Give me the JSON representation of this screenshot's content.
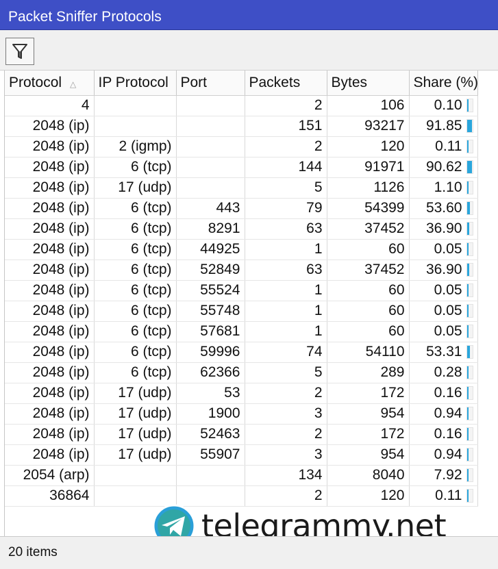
{
  "window": {
    "title": "Packet Sniffer Protocols"
  },
  "toolbar": {
    "filter_icon": "filter-funnel-icon"
  },
  "columns": [
    "Protocol",
    "IP Protocol",
    "Port",
    "Packets",
    "Bytes",
    "Share (%)"
  ],
  "rows": [
    {
      "protocol": "4",
      "ip_protocol": "",
      "port": "",
      "packets": "2",
      "bytes": "106",
      "share": "0.10"
    },
    {
      "protocol": "2048 (ip)",
      "ip_protocol": "",
      "port": "",
      "packets": "151",
      "bytes": "93217",
      "share": "91.85"
    },
    {
      "protocol": "2048 (ip)",
      "ip_protocol": "2 (igmp)",
      "port": "",
      "packets": "2",
      "bytes": "120",
      "share": "0.11"
    },
    {
      "protocol": "2048 (ip)",
      "ip_protocol": "6 (tcp)",
      "port": "",
      "packets": "144",
      "bytes": "91971",
      "share": "90.62"
    },
    {
      "protocol": "2048 (ip)",
      "ip_protocol": "17 (udp)",
      "port": "",
      "packets": "5",
      "bytes": "1126",
      "share": "1.10"
    },
    {
      "protocol": "2048 (ip)",
      "ip_protocol": "6 (tcp)",
      "port": "443",
      "packets": "79",
      "bytes": "54399",
      "share": "53.60"
    },
    {
      "protocol": "2048 (ip)",
      "ip_protocol": "6 (tcp)",
      "port": "8291",
      "packets": "63",
      "bytes": "37452",
      "share": "36.90"
    },
    {
      "protocol": "2048 (ip)",
      "ip_protocol": "6 (tcp)",
      "port": "44925",
      "packets": "1",
      "bytes": "60",
      "share": "0.05"
    },
    {
      "protocol": "2048 (ip)",
      "ip_protocol": "6 (tcp)",
      "port": "52849",
      "packets": "63",
      "bytes": "37452",
      "share": "36.90"
    },
    {
      "protocol": "2048 (ip)",
      "ip_protocol": "6 (tcp)",
      "port": "55524",
      "packets": "1",
      "bytes": "60",
      "share": "0.05"
    },
    {
      "protocol": "2048 (ip)",
      "ip_protocol": "6 (tcp)",
      "port": "55748",
      "packets": "1",
      "bytes": "60",
      "share": "0.05"
    },
    {
      "protocol": "2048 (ip)",
      "ip_protocol": "6 (tcp)",
      "port": "57681",
      "packets": "1",
      "bytes": "60",
      "share": "0.05"
    },
    {
      "protocol": "2048 (ip)",
      "ip_protocol": "6 (tcp)",
      "port": "59996",
      "packets": "74",
      "bytes": "54110",
      "share": "53.31"
    },
    {
      "protocol": "2048 (ip)",
      "ip_protocol": "6 (tcp)",
      "port": "62366",
      "packets": "5",
      "bytes": "289",
      "share": "0.28"
    },
    {
      "protocol": "2048 (ip)",
      "ip_protocol": "17 (udp)",
      "port": "53",
      "packets": "2",
      "bytes": "172",
      "share": "0.16"
    },
    {
      "protocol": "2048 (ip)",
      "ip_protocol": "17 (udp)",
      "port": "1900",
      "packets": "3",
      "bytes": "954",
      "share": "0.94"
    },
    {
      "protocol": "2048 (ip)",
      "ip_protocol": "17 (udp)",
      "port": "52463",
      "packets": "2",
      "bytes": "172",
      "share": "0.16"
    },
    {
      "protocol": "2048 (ip)",
      "ip_protocol": "17 (udp)",
      "port": "55907",
      "packets": "3",
      "bytes": "954",
      "share": "0.94"
    },
    {
      "protocol": "2054 (arp)",
      "ip_protocol": "",
      "port": "",
      "packets": "134",
      "bytes": "8040",
      "share": "7.92"
    },
    {
      "protocol": "36864",
      "ip_protocol": "",
      "port": "",
      "packets": "2",
      "bytes": "120",
      "share": "0.11"
    }
  ],
  "status": {
    "items_text": "20 items"
  },
  "watermark": {
    "text": "telegrammy.net",
    "icon": "telegram-logo-icon"
  },
  "colors": {
    "titlebar": "#3e4fc6",
    "share_bar": "#2aa6dc"
  }
}
